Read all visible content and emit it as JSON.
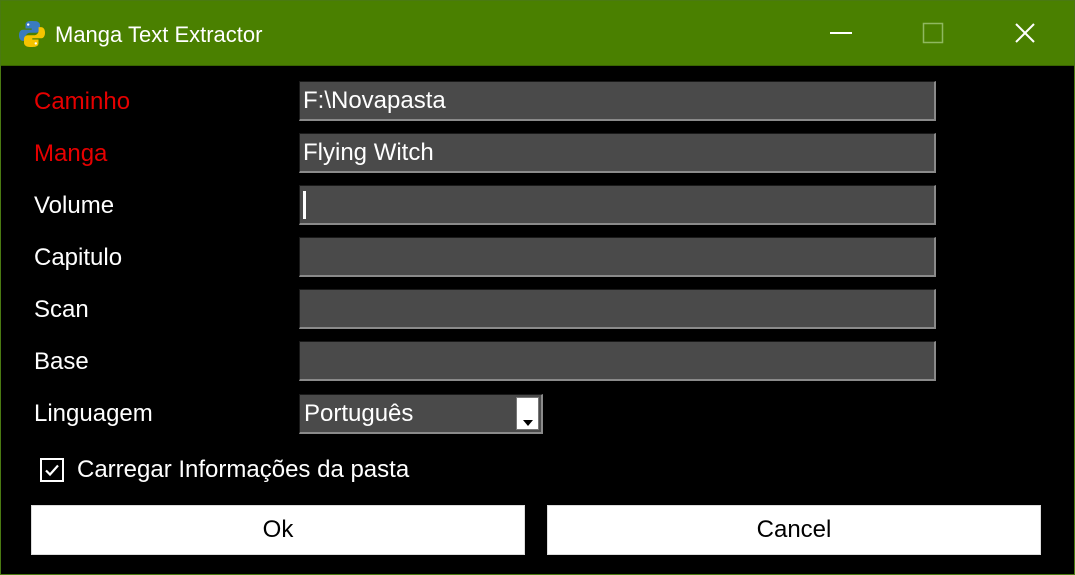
{
  "window": {
    "title": "Manga Text Extractor",
    "app_icon": "python-icon",
    "controls": [
      "minimize-icon",
      "maximize-icon",
      "close-icon"
    ],
    "titlebar_color": "#4a8000"
  },
  "form": {
    "fields": [
      {
        "label": "Caminho",
        "value": "F:\\Novapasta",
        "required": true
      },
      {
        "label": "Manga",
        "value": "Flying Witch",
        "required": true
      },
      {
        "label": "Volume",
        "value": "",
        "required": false
      },
      {
        "label": "Capitulo",
        "value": "",
        "required": false
      },
      {
        "label": "Scan",
        "value": "",
        "required": false
      },
      {
        "label": "Base",
        "value": "",
        "required": false
      }
    ],
    "language": {
      "label": "Linguagem",
      "selected": "Português"
    },
    "load_checkbox": {
      "label": "Carregar Informações da pasta",
      "checked": true
    },
    "required_label_color": "#e60000"
  },
  "buttons": {
    "ok": "Ok",
    "cancel": "Cancel"
  }
}
